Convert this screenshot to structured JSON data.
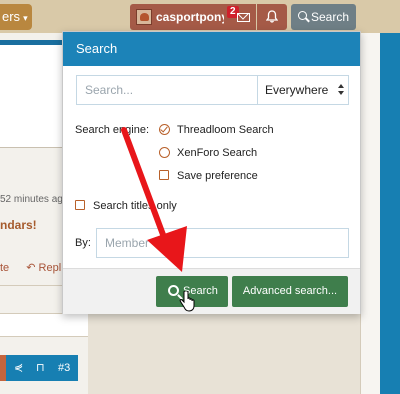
{
  "header": {
    "nav_fragment": "ers",
    "username": "casportpony",
    "inbox_badge": "2",
    "search_button": "Search"
  },
  "background": {
    "time_fragment": "52 minutes ag",
    "title_fragment": "ndars!",
    "action_left": "te",
    "action_reply": "Repl",
    "post_number": "#3"
  },
  "search_menu": {
    "title": "Search",
    "keywords_placeholder": "Search...",
    "scope_value": "Everywhere",
    "engine_label": "Search engine:",
    "engine_options": [
      {
        "label": "Threadloom Search",
        "selected": true
      },
      {
        "label": "XenForo Search",
        "selected": false
      }
    ],
    "save_preference": {
      "label": "Save preference",
      "checked": false
    },
    "titles_only": {
      "label": "Search titles only",
      "checked": false
    },
    "by_label": "By:",
    "member_placeholder": "Member",
    "submit_label": "Search",
    "advanced_label": "Advanced search..."
  },
  "colors": {
    "menu_header": "#1c83b8",
    "button_green": "#3f7e4c",
    "user_button": "#a55a47",
    "annotation_arrow": "#e8161a"
  }
}
